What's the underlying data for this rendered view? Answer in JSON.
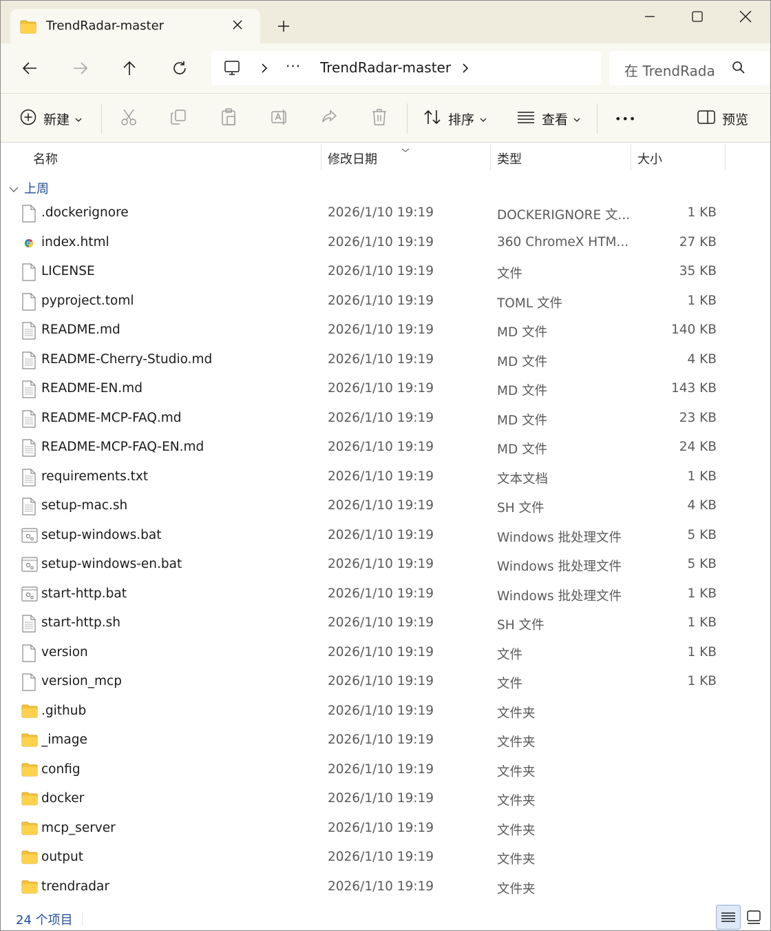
{
  "window": {
    "tab_title": "TrendRadar-master"
  },
  "nav": {
    "address_more": "···",
    "address_path": "TrendRadar-master",
    "search_placeholder": "在 TrendRada"
  },
  "commands": {
    "new_label": "新建",
    "sort_label": "排序",
    "view_label": "查看",
    "more_label": "•••",
    "preview_label": "预览"
  },
  "columns": {
    "name": "名称",
    "date": "修改日期",
    "type": "类型",
    "size": "大小"
  },
  "group": {
    "label": "上周"
  },
  "files": [
    {
      "name": ".dockerignore",
      "date": "2026/1/10 19:19",
      "type": "DOCKERIGNORE 文...",
      "size": "1 KB",
      "icon": "blank-file-icon"
    },
    {
      "name": "index.html",
      "date": "2026/1/10 19:19",
      "type": "360 ChromeX HTM...",
      "size": "27 KB",
      "icon": "html-file-icon"
    },
    {
      "name": "LICENSE",
      "date": "2026/1/10 19:19",
      "type": "文件",
      "size": "35 KB",
      "icon": "blank-file-icon"
    },
    {
      "name": "pyproject.toml",
      "date": "2026/1/10 19:19",
      "type": "TOML 文件",
      "size": "1 KB",
      "icon": "blank-file-icon"
    },
    {
      "name": "README.md",
      "date": "2026/1/10 19:19",
      "type": "MD 文件",
      "size": "140 KB",
      "icon": "text-file-icon"
    },
    {
      "name": "README-Cherry-Studio.md",
      "date": "2026/1/10 19:19",
      "type": "MD 文件",
      "size": "4 KB",
      "icon": "text-file-icon"
    },
    {
      "name": "README-EN.md",
      "date": "2026/1/10 19:19",
      "type": "MD 文件",
      "size": "143 KB",
      "icon": "text-file-icon"
    },
    {
      "name": "README-MCP-FAQ.md",
      "date": "2026/1/10 19:19",
      "type": "MD 文件",
      "size": "23 KB",
      "icon": "text-file-icon"
    },
    {
      "name": "README-MCP-FAQ-EN.md",
      "date": "2026/1/10 19:19",
      "type": "MD 文件",
      "size": "24 KB",
      "icon": "text-file-icon"
    },
    {
      "name": "requirements.txt",
      "date": "2026/1/10 19:19",
      "type": "文本文档",
      "size": "1 KB",
      "icon": "text-file-icon"
    },
    {
      "name": "setup-mac.sh",
      "date": "2026/1/10 19:19",
      "type": "SH 文件",
      "size": "4 KB",
      "icon": "text-file-icon"
    },
    {
      "name": "setup-windows.bat",
      "date": "2026/1/10 19:19",
      "type": "Windows 批处理文件",
      "size": "5 KB",
      "icon": "batch-file-icon"
    },
    {
      "name": "setup-windows-en.bat",
      "date": "2026/1/10 19:19",
      "type": "Windows 批处理文件",
      "size": "5 KB",
      "icon": "batch-file-icon"
    },
    {
      "name": "start-http.bat",
      "date": "2026/1/10 19:19",
      "type": "Windows 批处理文件",
      "size": "1 KB",
      "icon": "batch-file-icon"
    },
    {
      "name": "start-http.sh",
      "date": "2026/1/10 19:19",
      "type": "SH 文件",
      "size": "1 KB",
      "icon": "text-file-icon"
    },
    {
      "name": "version",
      "date": "2026/1/10 19:19",
      "type": "文件",
      "size": "1 KB",
      "icon": "blank-file-icon"
    },
    {
      "name": "version_mcp",
      "date": "2026/1/10 19:19",
      "type": "文件",
      "size": "1 KB",
      "icon": "blank-file-icon"
    },
    {
      "name": ".github",
      "date": "2026/1/10 19:19",
      "type": "文件夹",
      "size": "",
      "icon": "folder-icon"
    },
    {
      "name": "_image",
      "date": "2026/1/10 19:19",
      "type": "文件夹",
      "size": "",
      "icon": "folder-icon"
    },
    {
      "name": "config",
      "date": "2026/1/10 19:19",
      "type": "文件夹",
      "size": "",
      "icon": "folder-icon"
    },
    {
      "name": "docker",
      "date": "2026/1/10 19:19",
      "type": "文件夹",
      "size": "",
      "icon": "folder-icon"
    },
    {
      "name": "mcp_server",
      "date": "2026/1/10 19:19",
      "type": "文件夹",
      "size": "",
      "icon": "folder-icon"
    },
    {
      "name": "output",
      "date": "2026/1/10 19:19",
      "type": "文件夹",
      "size": "",
      "icon": "folder-icon"
    },
    {
      "name": "trendradar",
      "date": "2026/1/10 19:19",
      "type": "文件夹",
      "size": "",
      "icon": "folder-icon"
    }
  ],
  "status": {
    "count": "24 个项目"
  },
  "colors": {
    "chrome": "#efecde",
    "toolbar": "#f9f8f1",
    "accent": "#1f4f9a",
    "folder": "#f5c33b"
  }
}
